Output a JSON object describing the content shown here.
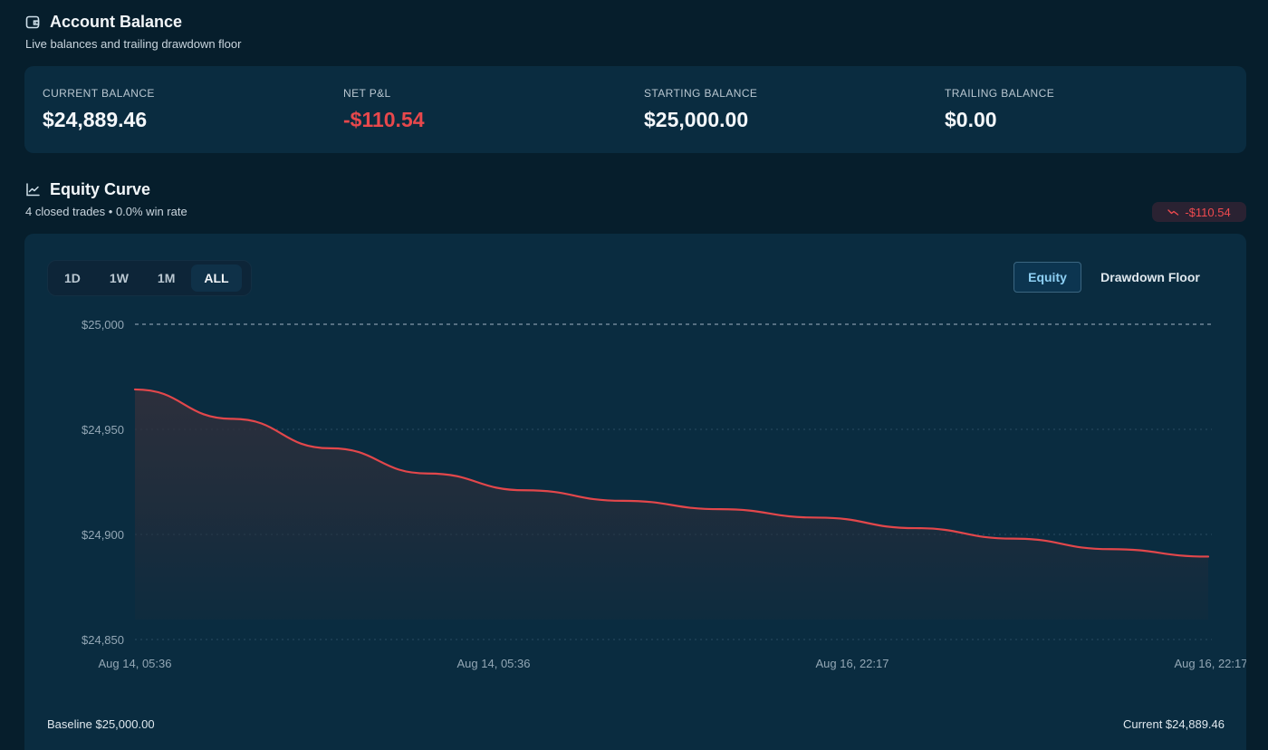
{
  "account": {
    "title": "Account Balance",
    "subtitle": "Live balances and trailing drawdown floor",
    "icon": "wallet-icon",
    "stats": [
      {
        "label": "CURRENT BALANCE",
        "value": "$24,889.46",
        "tone": "neutral"
      },
      {
        "label": "NET P&L",
        "value": "-$110.54",
        "tone": "negative"
      },
      {
        "label": "STARTING BALANCE",
        "value": "$25,000.00",
        "tone": "neutral"
      },
      {
        "label": "TRAILING BALANCE",
        "value": "$0.00",
        "tone": "neutral"
      }
    ]
  },
  "equity": {
    "title": "Equity Curve",
    "subtitle": "4 closed trades • 0.0% win rate",
    "icon": "line-chart-icon",
    "badge": {
      "value": "-$110.54",
      "icon": "trend-down-icon",
      "color": "#ef4a4f"
    },
    "ranges": [
      "1D",
      "1W",
      "1M",
      "ALL"
    ],
    "active_range": "ALL",
    "toggles": {
      "equity": "Equity",
      "floor": "Drawdown Floor"
    },
    "footer": {
      "baseline": "Baseline $25,000.00",
      "current": "Current $24,889.46"
    }
  },
  "chart_data": {
    "type": "area",
    "y_ticks": [
      25000,
      24950,
      24900,
      24850
    ],
    "y_tick_labels": [
      "$25,000",
      "$24,950",
      "$24,900",
      "$24,850"
    ],
    "x_tick_labels": [
      "Aug 14, 05:36",
      "Aug 14, 05:36",
      "Aug 16, 22:17",
      "Aug 16, 22:17"
    ],
    "ylim": [
      24850,
      25000
    ],
    "baseline": 25000,
    "grid": true,
    "line_color": "#e2474b",
    "series": [
      {
        "values": [
          24969,
          24955,
          24941,
          24929,
          24921,
          24916,
          24912,
          24908,
          24903,
          24898,
          24893,
          24889.46
        ]
      }
    ]
  }
}
